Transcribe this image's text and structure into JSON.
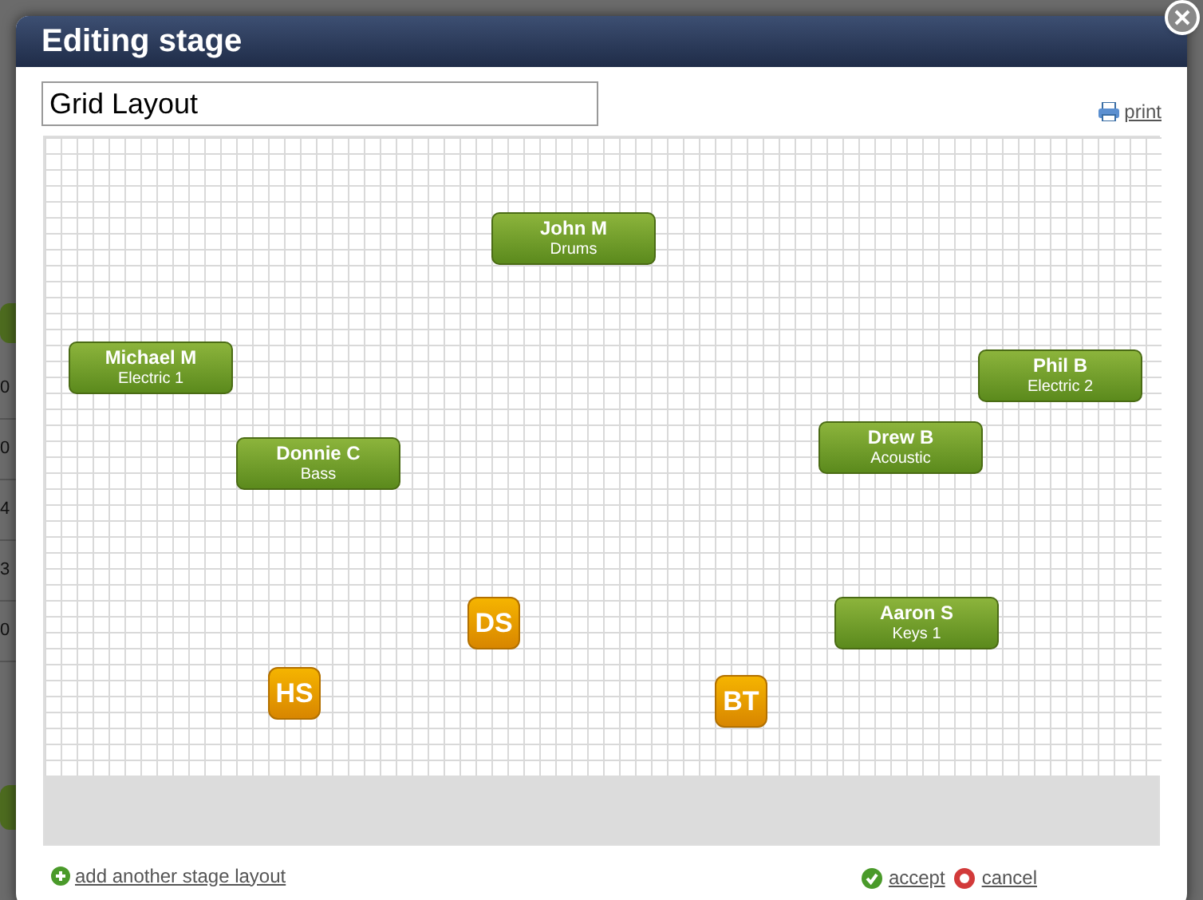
{
  "background_page": {
    "side_cells": [
      "0",
      "0",
      "4",
      "3",
      "0"
    ]
  },
  "dialog": {
    "title": "Editing stage",
    "layout_name": "Grid Layout",
    "print_link": "print",
    "stage": {
      "nodes": [
        {
          "kind": "musician",
          "name": "John M",
          "role": "Drums"
        },
        {
          "kind": "musician",
          "name": "Michael M",
          "role": "Electric 1"
        },
        {
          "kind": "musician",
          "name": "Phil B",
          "role": "Electric 2"
        },
        {
          "kind": "musician",
          "name": "Donnie C",
          "role": "Bass"
        },
        {
          "kind": "musician",
          "name": "Drew B",
          "role": "Acoustic"
        },
        {
          "kind": "marker",
          "label": "DS"
        },
        {
          "kind": "musician",
          "name": "Aaron S",
          "role": "Keys 1"
        },
        {
          "kind": "marker",
          "label": "HS"
        },
        {
          "kind": "marker",
          "label": "BT"
        }
      ]
    },
    "add_link": "add another stage layout",
    "accept_link": "accept",
    "cancel_link": "cancel"
  }
}
